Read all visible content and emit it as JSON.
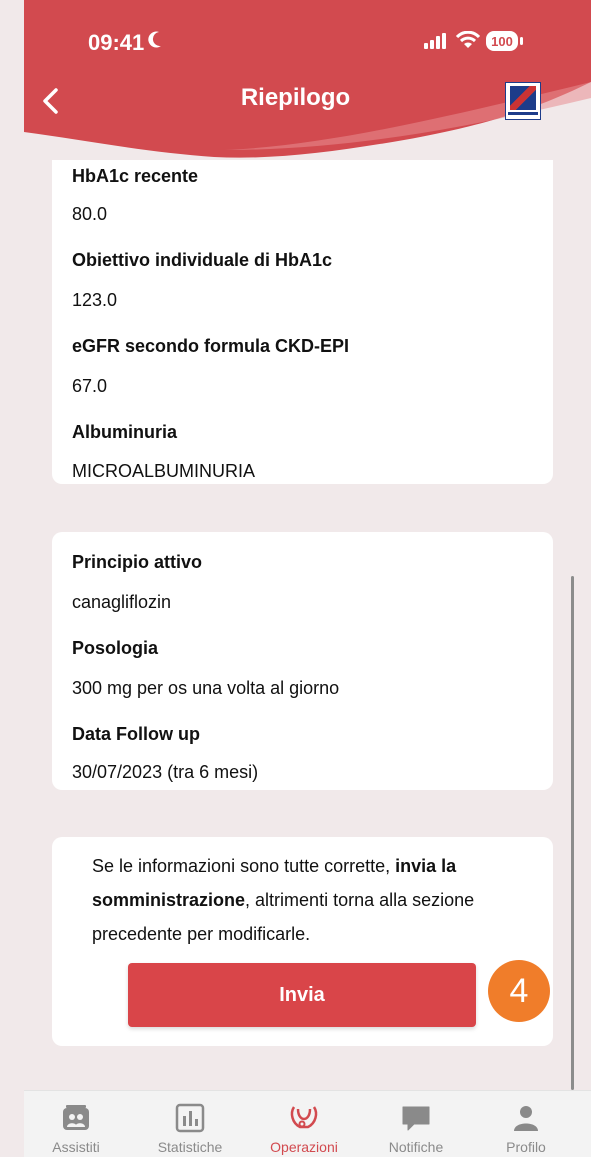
{
  "status_bar": {
    "time": "09:41",
    "battery": "100"
  },
  "header": {
    "title": "Riepilogo"
  },
  "card_clinical": {
    "fields": [
      {
        "label": "HbA1c recente",
        "value": "80.0"
      },
      {
        "label": "Obiettivo individuale di HbA1c",
        "value": "123.0"
      },
      {
        "label": "eGFR secondo formula CKD-EPI",
        "value": "67.0"
      },
      {
        "label": "Albuminuria",
        "value": "MICROALBUMINURIA"
      }
    ]
  },
  "card_therapy": {
    "fields": [
      {
        "label": "Principio attivo",
        "value": "canagliflozin"
      },
      {
        "label": "Posologia",
        "value": "300 mg per os una volta al giorno"
      },
      {
        "label": "Data Follow up",
        "value": "30/07/2023 (tra 6 mesi)"
      }
    ]
  },
  "confirm": {
    "text_before": "Se le informazioni sono tutte corrette, ",
    "text_bold": "invia la somministrazione",
    "text_after": ", altrimenti torna alla sezione precedente per modificarle.",
    "button_label": "Invia"
  },
  "step_badge": "4",
  "tabs": [
    {
      "label": "Assistiti",
      "icon": "people-icon"
    },
    {
      "label": "Statistiche",
      "icon": "chart-icon"
    },
    {
      "label": "Operazioni",
      "icon": "stethoscope-icon"
    },
    {
      "label": "Notifiche",
      "icon": "chat-icon"
    },
    {
      "label": "Profilo",
      "icon": "person-icon"
    }
  ],
  "colors": {
    "accent": "#d24a4f",
    "button": "#d94549",
    "badge": "#f07d2a",
    "background": "#f1e9ea"
  }
}
